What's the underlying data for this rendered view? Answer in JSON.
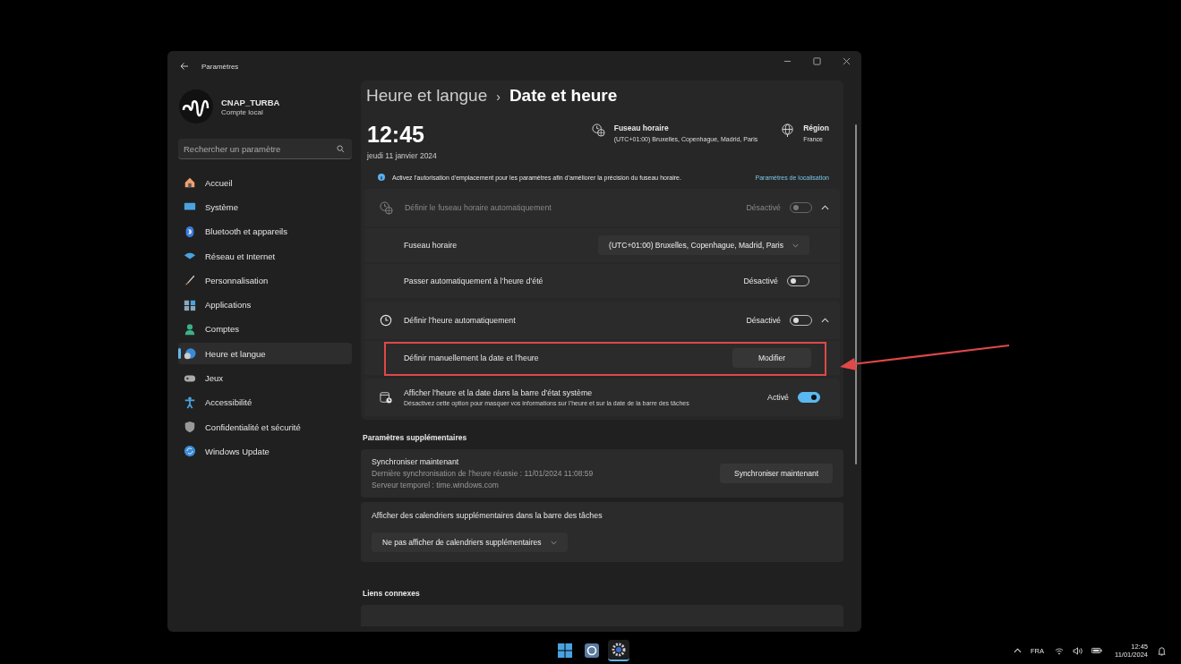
{
  "window": {
    "title": "Paramètres"
  },
  "account": {
    "name": "CNAP_TURBA",
    "type": "Compte local"
  },
  "search": {
    "placeholder": "Rechercher un paramètre"
  },
  "sidebar": {
    "items": [
      {
        "label": "Accueil",
        "selected": false
      },
      {
        "label": "Système",
        "selected": false
      },
      {
        "label": "Bluetooth et appareils",
        "selected": false
      },
      {
        "label": "Réseau et Internet",
        "selected": false
      },
      {
        "label": "Personnalisation",
        "selected": false
      },
      {
        "label": "Applications",
        "selected": false
      },
      {
        "label": "Comptes",
        "selected": false
      },
      {
        "label": "Heure et langue",
        "selected": true
      },
      {
        "label": "Jeux",
        "selected": false
      },
      {
        "label": "Accessibilité",
        "selected": false
      },
      {
        "label": "Confidentialité et sécurité",
        "selected": false
      },
      {
        "label": "Windows Update",
        "selected": false
      }
    ]
  },
  "breadcrumb": {
    "parent": "Heure et langue",
    "separator": "›",
    "current": "Date et heure"
  },
  "clock": {
    "time": "12:45",
    "date": "jeudi 11 janvier 2024"
  },
  "timezone": {
    "label": "Fuseau horaire",
    "value": "(UTC+01:00) Bruxelles, Copenhague, Madrid, Paris"
  },
  "region": {
    "label": "Région",
    "value": "France"
  },
  "info_banner": {
    "text": "Activez l’autorisation d’emplacement pour les paramètres afin d’améliorer la précision du fuseau horaire.",
    "link": "Paramètres de localisation"
  },
  "groups": [
    {
      "rows": [
        {
          "kind": "toggle",
          "label": "Définir le fuseau horaire automatiquement",
          "disabled": true,
          "state_label": "Désactivé",
          "on": false,
          "expanded": true
        },
        {
          "kind": "dropdown",
          "label": "Fuseau horaire",
          "value": "(UTC+01:00) Bruxelles, Copenhague, Madrid, Paris"
        },
        {
          "kind": "toggle",
          "label": "Passer automatiquement à l’heure d’été",
          "disabled": false,
          "state_label": "Désactivé",
          "on": false
        }
      ]
    },
    {
      "rows": [
        {
          "kind": "toggle",
          "label": "Définir l’heure automatiquement",
          "disabled": false,
          "state_label": "Désactivé",
          "on": false,
          "expanded": true
        },
        {
          "kind": "button",
          "label": "Définir manuellement la date et l’heure",
          "button": "Modifier",
          "highlighted": true
        }
      ]
    },
    {
      "rows": [
        {
          "kind": "toggle",
          "label": "Afficher l’heure et la date dans la barre d’état système",
          "description": "Désactivez cette option pour masquer vos informations sur l’heure et sur la date de la barre des tâches",
          "disabled": false,
          "state_label": "Activé",
          "on": true
        }
      ]
    }
  ],
  "additional": {
    "title": "Paramètres supplémentaires",
    "sync": {
      "title": "Synchroniser maintenant",
      "lines": [
        "Dernière synchronisation de l’heure réussie : 11/01/2024 11:08:59",
        "Serveur temporel : time.windows.com"
      ],
      "button": "Synchroniser maintenant"
    },
    "calendars": {
      "label": "Afficher des calendriers supplémentaires dans la barre des tâches",
      "value": "Ne pas afficher de calendriers supplémentaires"
    }
  },
  "related": {
    "title": "Liens connexes"
  },
  "taskbar": {
    "apps": [
      {
        "selected": false
      },
      {
        "selected": false
      },
      {
        "selected": true
      }
    ],
    "language": "FRA",
    "time": "12:45",
    "date": "11/01/2024"
  }
}
